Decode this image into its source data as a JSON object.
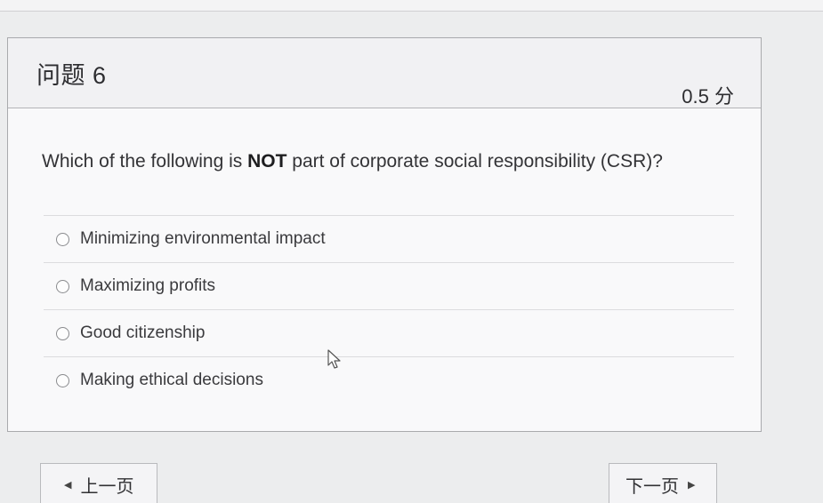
{
  "question": {
    "title": "问题 6",
    "points": "0.5 分",
    "text_before": "Which of the following is ",
    "text_emphasis": "NOT",
    "text_after": " part of corporate social responsibility (CSR)?"
  },
  "answers": [
    {
      "label": "Minimizing environmental impact"
    },
    {
      "label": "Maximizing profits"
    },
    {
      "label": "Good citizenship"
    },
    {
      "label": "Making ethical decisions"
    }
  ],
  "navigation": {
    "prev_label": "上一页",
    "next_label": "下一页"
  },
  "icons": {
    "prev": "triangle-left-icon",
    "next": "triangle-right-icon",
    "cursor": "mouse-pointer-icon",
    "radio": "radio-unselected"
  }
}
